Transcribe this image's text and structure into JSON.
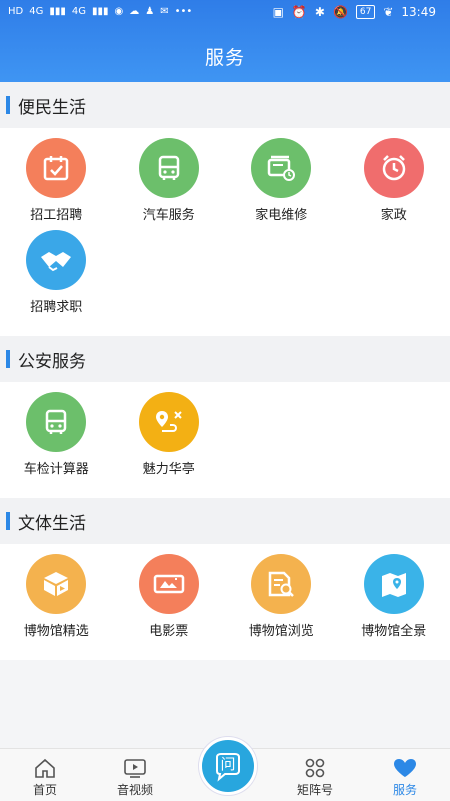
{
  "status": {
    "left_items": [
      "HD",
      "4G",
      "4G"
    ],
    "battery": "67",
    "time": "13:49"
  },
  "header": {
    "title": "服务"
  },
  "sections": [
    {
      "title": "便民生活",
      "items": [
        {
          "label": "招工招聘",
          "icon": "calendar-check-icon",
          "color": "#f47f5b"
        },
        {
          "label": "汽车服务",
          "icon": "bus-icon",
          "color": "#6cbf6b"
        },
        {
          "label": "家电维修",
          "icon": "appliance-repair-icon",
          "color": "#6cbf6b"
        },
        {
          "label": "家政",
          "icon": "alarm-clock-icon",
          "color": "#f06d6d"
        },
        {
          "label": "招聘求职",
          "icon": "handshake-icon",
          "color": "#3aa7e8"
        }
      ]
    },
    {
      "title": "公安服务",
      "items": [
        {
          "label": "车检计算器",
          "icon": "bus-icon",
          "color": "#6cbf6b"
        },
        {
          "label": "魅力华亭",
          "icon": "map-route-icon",
          "color": "#f3b014"
        }
      ]
    },
    {
      "title": "文体生活",
      "items": [
        {
          "label": "博物馆精选",
          "icon": "box-play-icon",
          "color": "#f4b24e"
        },
        {
          "label": "电影票",
          "icon": "ticket-icon",
          "color": "#f47f5b"
        },
        {
          "label": "博物馆浏览",
          "icon": "document-search-icon",
          "color": "#f4b24e"
        },
        {
          "label": "博物馆全景",
          "icon": "map-pin-icon",
          "color": "#3ab3e8"
        }
      ]
    }
  ],
  "tabbar": {
    "tabs": [
      {
        "label": "首页",
        "icon": "home-icon"
      },
      {
        "label": "音视频",
        "icon": "video-icon"
      },
      {
        "label": "矩阵号",
        "icon": "grid-icon"
      },
      {
        "label": "服务",
        "icon": "heart-icon"
      }
    ],
    "center_label": "问",
    "active": "服务"
  }
}
